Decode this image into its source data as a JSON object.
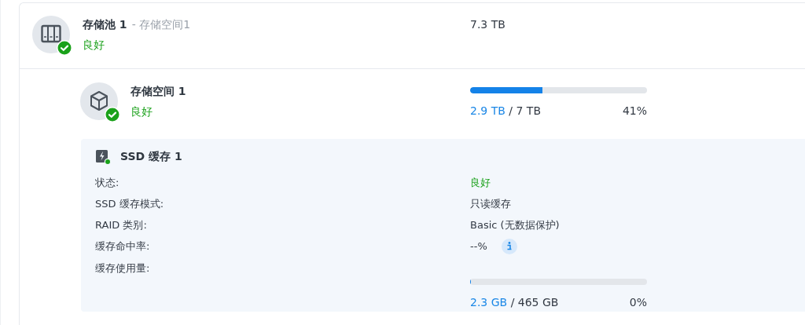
{
  "storage_pool": {
    "name": "存储池 1",
    "subtitle": "- 存储空间1",
    "status": "良好",
    "capacity": "7.3 TB"
  },
  "volume": {
    "name": "存储空间 1",
    "status": "良好",
    "level": 0.41,
    "used": "2.9 TB",
    "total": "/ 7 TB",
    "percent": "41%"
  },
  "ssd_cache": {
    "title": "SSD 缓存 1",
    "details": [
      {
        "label": "状态:",
        "value": "良好",
        "kind": "status"
      },
      {
        "label": "SSD 缓存模式:",
        "value": "只读缓存",
        "kind": "text"
      },
      {
        "label": "RAID 类别:",
        "value": "Basic (无数据保护)",
        "kind": "text"
      },
      {
        "label": "缓存命中率:",
        "value": "--%",
        "kind": "info"
      },
      {
        "label": "缓存使用量:",
        "kind": "usage"
      }
    ],
    "usage": {
      "level": 0.005,
      "used": "2.3 GB",
      "total": "/ 465 GB",
      "percent": "0%"
    }
  }
}
